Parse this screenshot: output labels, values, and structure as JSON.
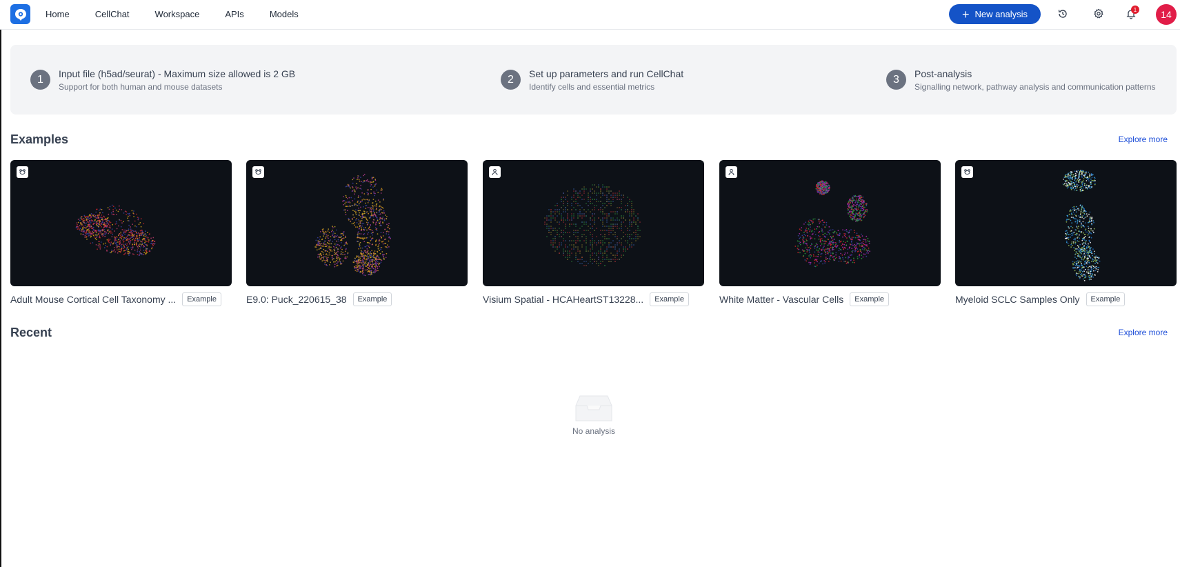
{
  "nav": {
    "links": [
      "Home",
      "CellChat",
      "Workspace",
      "APIs",
      "Models"
    ],
    "new_analysis_label": "New analysis",
    "notification_count": "1",
    "avatar_text": "14"
  },
  "steps": [
    {
      "num": "1",
      "title": "Input file (h5ad/seurat) - Maximum size allowed is 2 GB",
      "subtitle": "Support for both human and mouse datasets"
    },
    {
      "num": "2",
      "title": "Set up parameters and run CellChat",
      "subtitle": "Identify cells and essential metrics"
    },
    {
      "num": "3",
      "title": "Post-analysis",
      "subtitle": "Signalling network, pathway analysis and communication patterns"
    }
  ],
  "examples": {
    "title": "Examples",
    "explore_label": "Explore more",
    "items": [
      {
        "name": "Adult Mouse Cortical Cell Taxonomy ...",
        "tag": "Example",
        "badge_icon": "mouse-icon",
        "palette": [
          "#c0262d",
          "#3a3f9e",
          "#b83a6a",
          "#d4a017"
        ]
      },
      {
        "name": "E9.0: Puck_220615_38",
        "tag": "Example",
        "badge_icon": "mouse-icon",
        "palette": [
          "#c9a227",
          "#3b3fa0",
          "#b03a8a",
          "#d08a1e"
        ]
      },
      {
        "name": "Visium Spatial - HCAHeartST13228...",
        "tag": "Example",
        "badge_icon": "human-icon",
        "palette": [
          "#3a5fa8",
          "#2f8a3b",
          "#b0303a",
          "#8a7a2a"
        ]
      },
      {
        "name": "White Matter - Vascular Cells",
        "tag": "Example",
        "badge_icon": "human-icon",
        "palette": [
          "#2e9d3e",
          "#3a3f9e",
          "#d0262d",
          "#b02ab0"
        ]
      },
      {
        "name": "Myeloid SCLC Samples Only",
        "tag": "Example",
        "badge_icon": "mouse-icon",
        "palette": [
          "#1f6fbf",
          "#9ac45a",
          "#3aa0d8",
          "#ffffff"
        ]
      }
    ]
  },
  "recent": {
    "title": "Recent",
    "explore_label": "Explore more",
    "empty_text": "No analysis"
  }
}
